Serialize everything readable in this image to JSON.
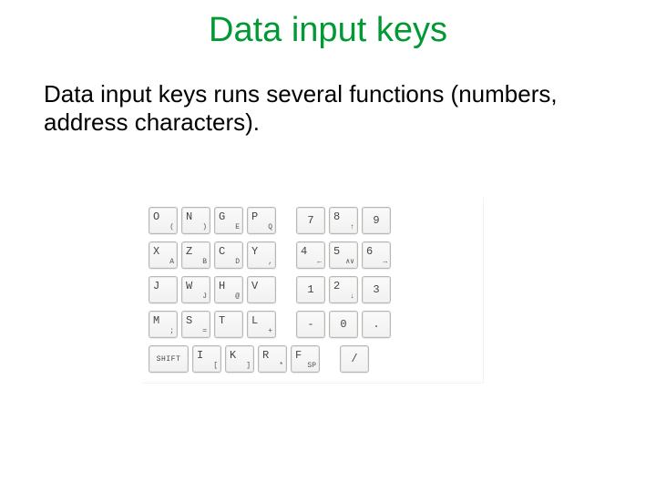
{
  "title": "Data input keys",
  "body": "Data input keys runs several functions (numbers, address characters).",
  "keyboard": {
    "rows": [
      [
        {
          "main": "O",
          "sub": "("
        },
        {
          "main": "N",
          "sub": ")"
        },
        {
          "main": "G",
          "sub": "E"
        },
        {
          "main": "P",
          "sub": "Q"
        },
        null,
        {
          "center": "7"
        },
        {
          "main": "8",
          "sub": "↑"
        },
        {
          "center": "9"
        }
      ],
      [
        {
          "main": "X",
          "sub": "A"
        },
        {
          "main": "Z",
          "sub": "B"
        },
        {
          "main": "C",
          "sub": "D"
        },
        {
          "main": "Y",
          "sub": ","
        },
        null,
        {
          "main": "4",
          "sub": "←"
        },
        {
          "main": "5",
          "sub": "∧∨"
        },
        {
          "main": "6",
          "sub": "→"
        }
      ],
      [
        {
          "main": "J",
          "sub": ""
        },
        {
          "main": "W",
          "sub": "J"
        },
        {
          "main": "H",
          "sub": "@"
        },
        {
          "main": "V",
          "sub": ""
        },
        null,
        {
          "center": "1"
        },
        {
          "main": "2",
          "sub": "↓"
        },
        {
          "center": "3"
        }
      ],
      [
        {
          "main": "M",
          "sub": ";"
        },
        {
          "main": "S",
          "sub": "="
        },
        {
          "main": "T",
          "sub": ""
        },
        {
          "main": "L",
          "sub": "+"
        },
        null,
        {
          "center": "-"
        },
        {
          "center": "0"
        },
        {
          "center": "."
        }
      ],
      [
        {
          "wide": true,
          "centerSmall": "SHIFT"
        },
        {
          "main": "I",
          "sub": "["
        },
        {
          "main": "K",
          "sub": "]"
        },
        {
          "main": "R",
          "sub": "*"
        },
        {
          "main": "F",
          "sub": "SP"
        },
        null,
        {
          "center": "/"
        }
      ]
    ]
  }
}
